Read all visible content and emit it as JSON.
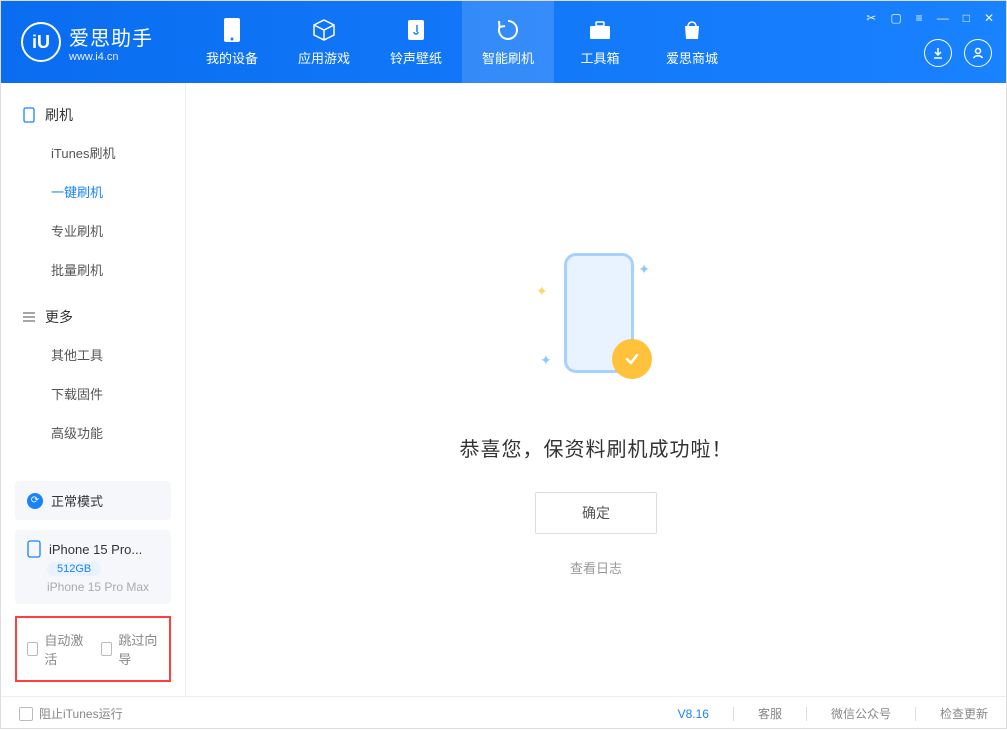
{
  "app": {
    "title": "爱思助手",
    "subtitle": "www.i4.cn"
  },
  "nav": {
    "items": [
      {
        "label": "我的设备"
      },
      {
        "label": "应用游戏"
      },
      {
        "label": "铃声壁纸"
      },
      {
        "label": "智能刷机"
      },
      {
        "label": "工具箱"
      },
      {
        "label": "爱思商城"
      }
    ]
  },
  "sidebar": {
    "group1": {
      "title": "刷机",
      "items": [
        {
          "label": "iTunes刷机"
        },
        {
          "label": "一键刷机"
        },
        {
          "label": "专业刷机"
        },
        {
          "label": "批量刷机"
        }
      ]
    },
    "group2": {
      "title": "更多",
      "items": [
        {
          "label": "其他工具"
        },
        {
          "label": "下载固件"
        },
        {
          "label": "高级功能"
        }
      ]
    },
    "mode": "正常模式",
    "device": {
      "name": "iPhone 15 Pro...",
      "storage": "512GB",
      "full": "iPhone 15 Pro Max"
    },
    "checks": {
      "auto_activate": "自动激活",
      "skip_guide": "跳过向导"
    }
  },
  "main": {
    "success": "恭喜您，保资料刷机成功啦！",
    "confirm": "确定",
    "view_log": "查看日志"
  },
  "footer": {
    "block_itunes": "阻止iTunes运行",
    "version": "V8.16",
    "links": {
      "service": "客服",
      "wechat": "微信公众号",
      "update": "检查更新"
    }
  }
}
